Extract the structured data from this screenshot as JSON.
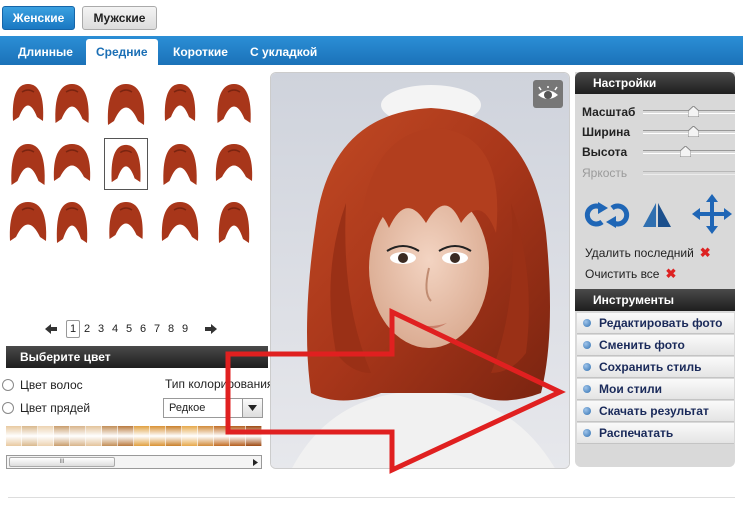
{
  "gender": {
    "female": "Женские",
    "male": "Мужские"
  },
  "tabs": [
    "Длинные",
    "Средние",
    "Короткие",
    "С укладкой"
  ],
  "selected_tab": "Средние",
  "pager": {
    "pages": [
      "1",
      "2",
      "3",
      "4",
      "5",
      "6",
      "7",
      "8",
      "9"
    ],
    "current": "1"
  },
  "color_panel": {
    "title": "Выберите цвет",
    "hair_color_label": "Цвет волос",
    "strands_color_label": "Цвет прядей",
    "coloring_type_label": "Тип колорирования",
    "coloring_type_value": "Редкое",
    "scroll_thumb_label": "III",
    "swatches": [
      "#e8c9a0",
      "#d9b88c",
      "#ecd2b0",
      "#c99d6c",
      "#d8b48a",
      "#e3c39a",
      "#c28e57",
      "#b97a3e",
      "#e0a040",
      "#d99234",
      "#c9802a",
      "#e6a84a",
      "#d18b3a",
      "#c26d24",
      "#b55f1e",
      "#9e4a12"
    ]
  },
  "settings": {
    "title": "Настройки",
    "scale_label": "Масштаб",
    "width_label": "Ширина",
    "height_label": "Высота",
    "brightness_label": "Яркость",
    "scale_level": 0.55,
    "width_level": 0.55,
    "height_level": 0.47,
    "delete_last_label": "Удалить последний",
    "clear_all_label": "Очистить все"
  },
  "tools": {
    "title": "Инструменты",
    "items": [
      "Редактировать фото",
      "Сменить фото",
      "Сохранить стиль",
      "Мои стили",
      "Скачать результат",
      "Распечатать"
    ]
  },
  "colors": {
    "accent": "#1b72b8",
    "hair": "#a8361a",
    "annotation": "#e02020"
  }
}
